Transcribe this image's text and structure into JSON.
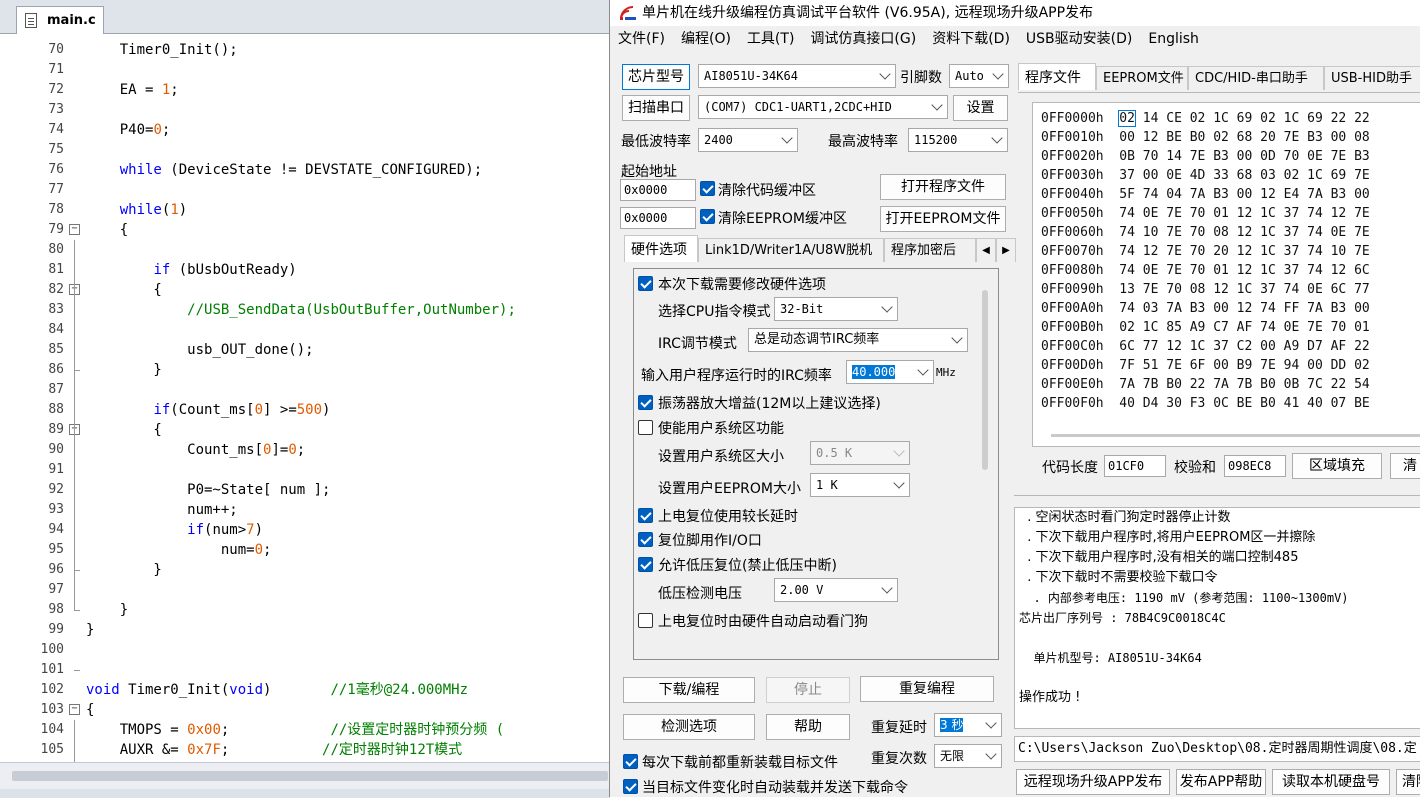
{
  "editor": {
    "tab": "main.c",
    "lines": [
      {
        "n": "70",
        "segs": [
          [
            "    Timer0_Init();",
            ""
          ]
        ]
      },
      {
        "n": "71",
        "segs": []
      },
      {
        "n": "72",
        "segs": [
          [
            "    EA = ",
            ""
          ],
          [
            "1",
            "num"
          ],
          [
            ";",
            ""
          ]
        ]
      },
      {
        "n": "73",
        "segs": []
      },
      {
        "n": "74",
        "segs": [
          [
            "    P40=",
            ""
          ],
          [
            "0",
            "num"
          ],
          [
            ";",
            ""
          ]
        ]
      },
      {
        "n": "75",
        "segs": []
      },
      {
        "n": "76",
        "segs": [
          [
            "    ",
            ""
          ],
          [
            "while",
            "kw"
          ],
          [
            " (DeviceState != DEVSTATE_CONFIGURED);",
            ""
          ]
        ]
      },
      {
        "n": "77",
        "segs": []
      },
      {
        "n": "78",
        "segs": [
          [
            "    ",
            ""
          ],
          [
            "while",
            "kw"
          ],
          [
            "(",
            ""
          ],
          [
            "1",
            "num"
          ],
          [
            ")",
            ""
          ]
        ]
      },
      {
        "n": "79",
        "segs": [
          [
            "    {",
            ""
          ]
        ]
      },
      {
        "n": "80",
        "segs": []
      },
      {
        "n": "81",
        "segs": [
          [
            "        ",
            ""
          ],
          [
            "if",
            "kw"
          ],
          [
            " (bUsbOutReady)",
            ""
          ]
        ]
      },
      {
        "n": "82",
        "segs": [
          [
            "        {",
            ""
          ]
        ]
      },
      {
        "n": "83",
        "segs": [
          [
            "            ",
            ""
          ],
          [
            "//USB_SendData(UsbOutBuffer,OutNumber);",
            "cm"
          ]
        ]
      },
      {
        "n": "84",
        "segs": []
      },
      {
        "n": "85",
        "segs": [
          [
            "            usb_OUT_done();",
            ""
          ]
        ]
      },
      {
        "n": "86",
        "segs": [
          [
            "        }",
            ""
          ]
        ]
      },
      {
        "n": "87",
        "segs": []
      },
      {
        "n": "88",
        "segs": [
          [
            "        ",
            ""
          ],
          [
            "if",
            "kw"
          ],
          [
            "(Count_ms[",
            ""
          ],
          [
            "0",
            "num"
          ],
          [
            "] >=",
            ""
          ],
          [
            "500",
            "num"
          ],
          [
            ")",
            ""
          ]
        ]
      },
      {
        "n": "89",
        "segs": [
          [
            "        {",
            ""
          ]
        ]
      },
      {
        "n": "90",
        "segs": [
          [
            "            Count_ms[",
            ""
          ],
          [
            "0",
            "num"
          ],
          [
            "]=",
            ""
          ],
          [
            "0",
            "num"
          ],
          [
            ";",
            ""
          ]
        ]
      },
      {
        "n": "91",
        "segs": []
      },
      {
        "n": "92",
        "segs": [
          [
            "            P0=~State[ num ];",
            ""
          ]
        ]
      },
      {
        "n": "93",
        "segs": [
          [
            "            num++;",
            ""
          ]
        ]
      },
      {
        "n": "94",
        "segs": [
          [
            "            ",
            ""
          ],
          [
            "if",
            "kw"
          ],
          [
            "(num>",
            ""
          ],
          [
            "7",
            "num"
          ],
          [
            ")",
            ""
          ]
        ]
      },
      {
        "n": "95",
        "segs": [
          [
            "                num=",
            ""
          ],
          [
            "0",
            "num"
          ],
          [
            ";",
            ""
          ]
        ]
      },
      {
        "n": "96",
        "segs": [
          [
            "        }",
            ""
          ]
        ]
      },
      {
        "n": "97",
        "segs": []
      },
      {
        "n": "98",
        "segs": [
          [
            "    }",
            ""
          ]
        ]
      },
      {
        "n": "99",
        "segs": [
          [
            "}",
            ""
          ]
        ]
      },
      {
        "n": "100",
        "segs": []
      },
      {
        "n": "101",
        "segs": []
      },
      {
        "n": "102",
        "segs": [
          [
            "void",
            "kw"
          ],
          [
            " Timer0_Init(",
            ""
          ],
          [
            "void",
            "kw"
          ],
          [
            ")       ",
            ""
          ],
          [
            "//1毫秒@24.000MHz",
            "cm"
          ]
        ]
      },
      {
        "n": "103",
        "segs": [
          [
            "{",
            ""
          ]
        ]
      },
      {
        "n": "104",
        "segs": [
          [
            "    TMOPS = ",
            ""
          ],
          [
            "0x00",
            "num"
          ],
          [
            ";            ",
            ""
          ],
          [
            "//设置定时器时钟预分频 (",
            "cm"
          ]
        ]
      },
      {
        "n": "105",
        "segs": [
          [
            "    AUXR &= ",
            ""
          ],
          [
            "0x7F",
            "num"
          ],
          [
            ";           ",
            ""
          ],
          [
            "//定时器时钟12T模式",
            "cm"
          ]
        ]
      }
    ]
  },
  "app": {
    "title": "单片机在线升级编程仿真调试平台软件 (V6.95A), 远程现场升级APP发布",
    "menu": [
      "文件(F)",
      "编程(O)",
      "工具(T)",
      "调试仿真接口(G)",
      "资料下载(D)",
      "USB驱动安装(D)",
      "English"
    ],
    "chip_label": "芯片型号",
    "chip_value": "AI8051U-34K64",
    "pins_label": "引脚数",
    "pins_value": "Auto",
    "scan_label": "扫描串口",
    "port_value": "(COM7) CDC1-UART1,2CDC+HID",
    "settings_label": "设置",
    "min_baud_label": "最低波特率",
    "min_baud": "2400",
    "max_baud_label": "最高波特率",
    "max_baud": "115200",
    "start_addr_label": "起始地址",
    "addr1": "0x0000",
    "clear_code": "清除代码缓冲区",
    "open_prog": "打开程序文件",
    "addr2": "0x0000",
    "clear_eeprom": "清除EEPROM缓冲区",
    "open_eeprom": "打开EEPROM文件",
    "opt_tabs": [
      "硬件选项",
      "Link1D/Writer1A/U8W脱机",
      "程序加密后"
    ],
    "opts": {
      "modify_hw": "本次下载需要修改硬件选项",
      "cpu_mode_label": "选择CPU指令模式",
      "cpu_mode": "32-Bit",
      "irc_mode_label": "IRC调节模式",
      "irc_mode": "总是动态调节IRC频率",
      "irc_freq_label": "输入用户程序运行时的IRC频率",
      "irc_freq": "40.000",
      "irc_unit": "MHz",
      "osc_gain": "振荡器放大增益(12M以上建议选择)",
      "user_sys": "使能用户系统区功能",
      "user_sys_size_label": "设置用户系统区大小",
      "user_sys_size": "0.5 K",
      "user_eeprom_label": "设置用户EEPROM大小",
      "user_eeprom": "1    K",
      "long_delay": "上电复位使用较长延时",
      "reset_io": "复位脚用作I/O口",
      "lvr": "允许低压复位(禁止低压中断)",
      "lvd_label": "低压检测电压",
      "lvd": "2.00 V",
      "wdt": "上电复位时由硬件自动启动看门狗"
    },
    "btn_download": "下载/编程",
    "btn_stop": "停止",
    "btn_reprog": "重复编程",
    "btn_detect": "检测选项",
    "btn_help": "帮助",
    "repeat_delay_label": "重复延时",
    "repeat_delay": "3 秒",
    "repeat_count_label": "重复次数",
    "repeat_count": "无限",
    "reload_each": "每次下载前都重新装载目标文件",
    "auto_reload": "当目标文件变化时自动装载并发送下载命令",
    "right_tabs": [
      "程序文件",
      "EEPROM文件",
      "CDC/HID-串口助手",
      "USB-HID助手"
    ],
    "hex_rows": [
      {
        "a": "0FF0000h",
        "b": "14 CE 02 1C 69 02 1C 69 22 22",
        "f": "02"
      },
      {
        "a": "0FF0010h",
        "b": "00 12 BE B0 02 68 20 7E B3 00 08"
      },
      {
        "a": "0FF0020h",
        "b": "0B 70 14 7E B3 00 0D 70 0E 7E B3"
      },
      {
        "a": "0FF0030h",
        "b": "37 00 0E 4D 33 68 03 02 1C 69 7E"
      },
      {
        "a": "0FF0040h",
        "b": "5F 74 04 7A B3 00 12 E4 7A B3 00"
      },
      {
        "a": "0FF0050h",
        "b": "74 0E 7E 70 01 12 1C 37 74 12 7E"
      },
      {
        "a": "0FF0060h",
        "b": "74 10 7E 70 08 12 1C 37 74 0E 7E"
      },
      {
        "a": "0FF0070h",
        "b": "74 12 7E 70 20 12 1C 37 74 10 7E"
      },
      {
        "a": "0FF0080h",
        "b": "74 0E 7E 70 01 12 1C 37 74 12 6C"
      },
      {
        "a": "0FF0090h",
        "b": "13 7E 70 08 12 1C 37 74 0E 6C 77"
      },
      {
        "a": "0FF00A0h",
        "b": "74 03 7A B3 00 12 74 FF 7A B3 00"
      },
      {
        "a": "0FF00B0h",
        "b": "02 1C 85 A9 C7 AF 74 0E 7E 70 01"
      },
      {
        "a": "0FF00C0h",
        "b": "6C 77 12 1C 37 C2 00 A9 D7 AF 22"
      },
      {
        "a": "0FF00D0h",
        "b": "7F 51 7E 6F 00 B9 7E 94 00 DD 02"
      },
      {
        "a": "0FF00E0h",
        "b": "7A 7B B0 22 7A 7B B0 0B 7C 22 54"
      },
      {
        "a": "0FF00F0h",
        "b": "40 D4 30 F3 0C BE B0 41 40 07 BE"
      }
    ],
    "code_len_label": "代码长度",
    "code_len": "01CF0",
    "checksum_label": "校验和",
    "checksum": "098EC8",
    "fill_label": "区域填充",
    "clear_label": "清",
    "log": [
      {
        "t": "  . 空闲状态时看门狗定时器停止计数",
        "m": false
      },
      {
        "t": "  . 下次下载用户程序时,将用户EEPROM区一并擦除",
        "m": false
      },
      {
        "t": "  . 下次下载用户程序时,没有相关的端口控制485",
        "m": false
      },
      {
        "t": "  . 下次下载时不需要校验下载口令",
        "m": false
      },
      {
        "t": "  . 内部参考电压: 1190 mV (参考范围: 1100~1300mV)",
        "m": true
      },
      {
        "t": "芯片出厂序列号 : 78B4C9C0018C4C",
        "m": true
      },
      {
        "t": "",
        "m": false
      },
      {
        "t": "  单片机型号: AI8051U-34K64",
        "m": true
      },
      {
        "t": "",
        "m": false
      },
      {
        "t": "操作成功 !",
        "m": false
      }
    ],
    "path": "C:\\Users\\Jackson Zuo\\Desktop\\08.定时器周期性调度\\08.定",
    "bottom_btns": [
      "远程现场升级APP发布",
      "发布APP帮助",
      "读取本机硬盘号",
      "清除"
    ]
  },
  "colors": {
    "accent": "#0078d7",
    "keyword": "#0000ff",
    "number": "#e05a00",
    "comment": "#008000"
  }
}
